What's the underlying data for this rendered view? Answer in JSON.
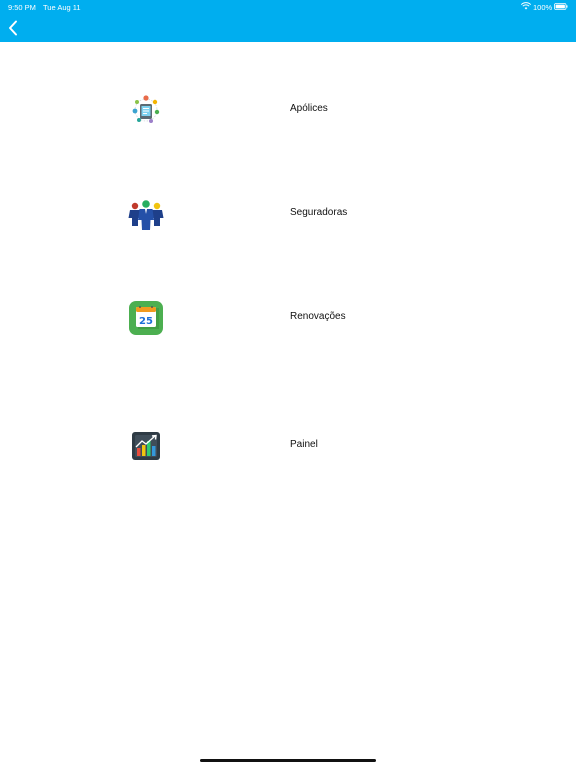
{
  "status_bar": {
    "time": "9:50 PM",
    "date": "Tue Aug 11",
    "battery": "100%"
  },
  "nav": {
    "back_icon": "chevron-left-icon",
    "color": "#00aeef"
  },
  "menu": {
    "items": [
      {
        "label": "Apólices",
        "icon": "policies-icon"
      },
      {
        "label": "Seguradoras",
        "icon": "insurers-icon"
      },
      {
        "label": "Renovações",
        "icon": "calendar-icon"
      },
      {
        "label": "Painel",
        "icon": "dashboard-chart-icon"
      }
    ]
  },
  "calendar_day": "25"
}
